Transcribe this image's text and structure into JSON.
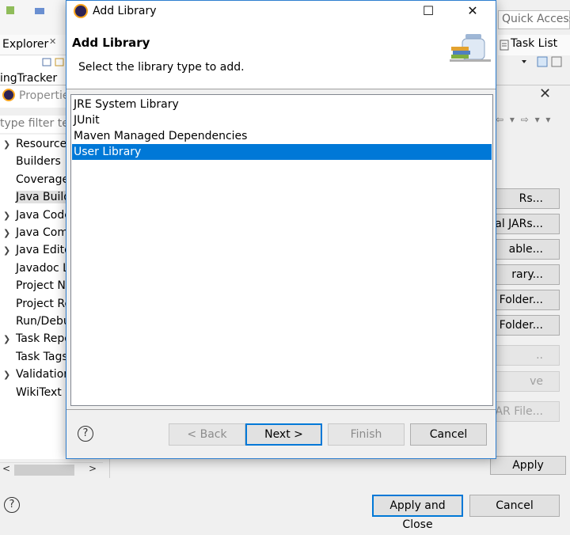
{
  "eclipse": {
    "explorer_tab": "Explorer",
    "project_name": "ingTracker",
    "quick_access_placeholder": "Quick Access",
    "task_list_tab": "Task List"
  },
  "properties": {
    "title": "Propertie",
    "filter_placeholder": "type filter tex",
    "tree": [
      {
        "label": "Resource",
        "expandable": true
      },
      {
        "label": "Builders",
        "expandable": false
      },
      {
        "label": "Coverage",
        "expandable": false
      },
      {
        "label": "Java Build",
        "expandable": false,
        "selected": true
      },
      {
        "label": "Java Code",
        "expandable": true
      },
      {
        "label": "Java Comp",
        "expandable": true
      },
      {
        "label": "Java Edito",
        "expandable": true
      },
      {
        "label": "Javadoc L",
        "expandable": false
      },
      {
        "label": "Project Na",
        "expandable": false
      },
      {
        "label": "Project Re",
        "expandable": false
      },
      {
        "label": "Run/Debu",
        "expandable": false
      },
      {
        "label": "Task Repo",
        "expandable": true
      },
      {
        "label": "Task Tags",
        "expandable": false
      },
      {
        "label": "Validation",
        "expandable": true
      },
      {
        "label": "WikiText",
        "expandable": false
      }
    ],
    "side_buttons": [
      {
        "label": "Rs...",
        "enabled": true
      },
      {
        "label": "al JARs...",
        "enabled": true
      },
      {
        "label": "able...",
        "enabled": true
      },
      {
        "label": "rary...",
        "enabled": true
      },
      {
        "label": "Folder...",
        "enabled": true
      },
      {
        "label": "ass Folder...",
        "enabled": true
      },
      {
        "label": "..",
        "enabled": false
      },
      {
        "label": "ve",
        "enabled": false
      },
      {
        "label": "AR File...",
        "enabled": false
      }
    ],
    "apply_label": "Apply",
    "apply_close_label": "Apply and Close",
    "cancel_label": "Cancel"
  },
  "dialog": {
    "window_title": "Add Library",
    "heading": "Add Library",
    "description": "Select the library type to add.",
    "library_types": [
      {
        "label": "JRE System Library",
        "selected": false
      },
      {
        "label": "JUnit",
        "selected": false
      },
      {
        "label": "Maven Managed Dependencies",
        "selected": false
      },
      {
        "label": "User Library",
        "selected": true
      }
    ],
    "buttons": {
      "back": "< Back",
      "next": "Next >",
      "finish": "Finish",
      "cancel": "Cancel"
    },
    "help_glyph": "?"
  },
  "colors": {
    "selection": "#0078d7",
    "dialog_border": "#2e7ecf",
    "eclipse_logo": "#2c2255",
    "eclipse_logo_ring": "#f7a41d"
  }
}
